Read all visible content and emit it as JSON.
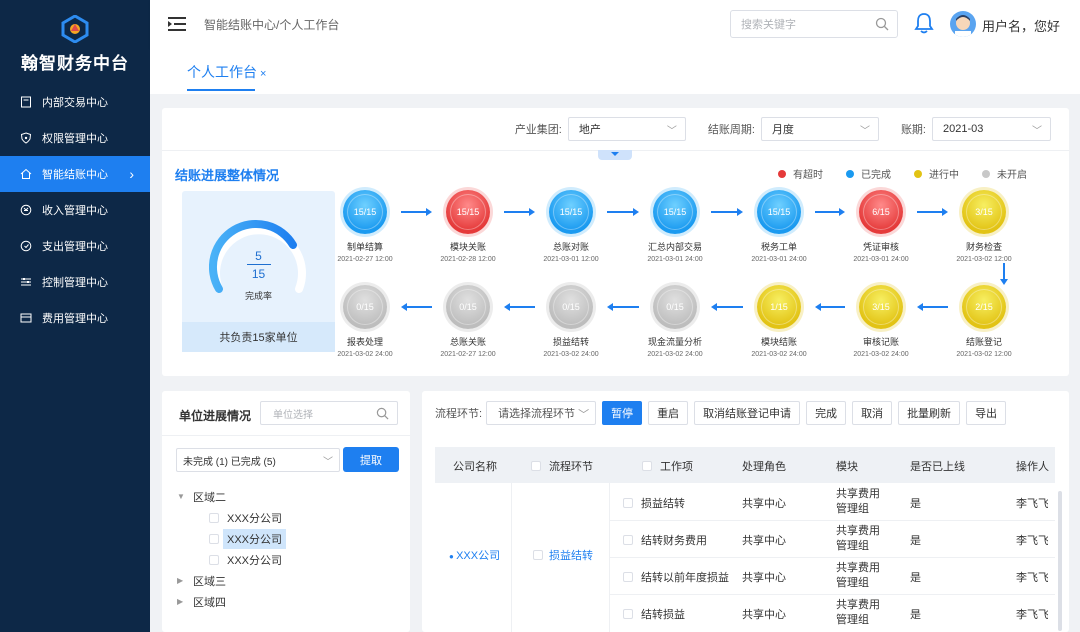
{
  "app": {
    "logo_text": "翰智财务中台",
    "breadcrumb": "智能结账中心/个人工作台",
    "search_placeholder": "搜索关键字",
    "username": "用户名，您好"
  },
  "sidebar": {
    "items": [
      {
        "label": "内部交易中心",
        "icon": "document-icon"
      },
      {
        "label": "权限管理中心",
        "icon": "shield-icon"
      },
      {
        "label": "智能结账中心",
        "icon": "home-icon"
      },
      {
        "label": "收入管理中心",
        "icon": "income-icon"
      },
      {
        "label": "支出管理中心",
        "icon": "expense-icon"
      },
      {
        "label": "控制管理中心",
        "icon": "sliders-icon"
      },
      {
        "label": "费用管理中心",
        "icon": "card-icon"
      }
    ],
    "active_index": 2
  },
  "tabs": [
    {
      "label": "个人工作台",
      "close": "×"
    }
  ],
  "filters": {
    "group_label": "产业集团:",
    "group_value": "地产",
    "period_label": "结账周期:",
    "period_value": "月度",
    "term_label": "账期:",
    "term_value": "2021-03"
  },
  "progress": {
    "title": "结账进展整体情况",
    "legend": [
      {
        "label": "有超时",
        "color": "#e53a3a"
      },
      {
        "label": "已完成",
        "color": "#1a9af0"
      },
      {
        "label": "进行中",
        "color": "#e2c314"
      },
      {
        "label": "未开启",
        "color": "#c8c8c8"
      }
    ],
    "summary": {
      "numerator": "5",
      "denominator": "15",
      "rate_label": "完成率",
      "footer": "共负责15家单位",
      "completion_fraction": 0.33
    },
    "row1": [
      {
        "count": "15/15",
        "name": "制单结算",
        "time": "2021-02-27 12:00",
        "status": "blue"
      },
      {
        "count": "15/15",
        "name": "模块关账",
        "time": "2021-02-28 12:00",
        "status": "red"
      },
      {
        "count": "15/15",
        "name": "总账对账",
        "time": "2021-03-01 12:00",
        "status": "blue"
      },
      {
        "count": "15/15",
        "name": "汇总内部交易",
        "time": "2021-03-01 24:00",
        "status": "blue"
      },
      {
        "count": "15/15",
        "name": "税务工单",
        "time": "2021-03-01 24:00",
        "status": "blue"
      },
      {
        "count": "6/15",
        "name": "凭证审核",
        "time": "2021-03-01 24:00",
        "status": "red"
      },
      {
        "count": "3/15",
        "name": "财务检查",
        "time": "2021-03-02 12:00",
        "status": "yellow"
      }
    ],
    "row2": [
      {
        "count": "0/15",
        "name": "报表处理",
        "time": "2021-03-02 24:00",
        "status": "gray"
      },
      {
        "count": "0/15",
        "name": "总账关账",
        "time": "2021-02-27 12:00",
        "status": "gray"
      },
      {
        "count": "0/15",
        "name": "损益结转",
        "time": "2021-03-02 24:00",
        "status": "gray"
      },
      {
        "count": "0/15",
        "name": "现金流量分析",
        "time": "2021-03-02 24:00",
        "status": "gray"
      },
      {
        "count": "1/15",
        "name": "模块结账",
        "time": "2021-03-02 24:00",
        "status": "yellow"
      },
      {
        "count": "3/15",
        "name": "审核记账",
        "time": "2021-03-02 24:00",
        "status": "yellow"
      },
      {
        "count": "2/15",
        "name": "结账登记",
        "time": "2021-03-02 12:00",
        "status": "yellow"
      }
    ]
  },
  "unit_panel": {
    "title": "单位进展情况",
    "search_placeholder": "单位选择",
    "status_filter": "未完成 (1)  已完成 (5)",
    "fetch_button": "提取",
    "tree": [
      {
        "label": "区域二",
        "expanded": true,
        "children": [
          "XXX分公司",
          "XXX分公司",
          "XXX分公司"
        ]
      },
      {
        "label": "区域三",
        "expanded": false
      },
      {
        "label": "区域四",
        "expanded": false
      }
    ],
    "selected_child": 1
  },
  "process_panel": {
    "label": "流程环节:",
    "select_placeholder": "请选择流程环节",
    "buttons": [
      "暂停",
      "重启",
      "取消结账登记申请",
      "完成",
      "取消",
      "批量刷新",
      "导出"
    ],
    "columns": [
      "公司名称",
      "流程环节",
      "工作项",
      "处理角色",
      "模块",
      "是否已上线",
      "操作人"
    ],
    "company": "XXX公司",
    "process": "损益结转",
    "rows": [
      {
        "work": "损益结转",
        "role": "共享中心",
        "module": [
          "共享费用",
          "管理组"
        ],
        "online": "是",
        "operator": "李飞飞"
      },
      {
        "work": "结转财务费用",
        "role": "共享中心",
        "module": [
          "共享费用",
          "管理组"
        ],
        "online": "是",
        "operator": "李飞飞"
      },
      {
        "work": "结转以前年度损益",
        "role": "共享中心",
        "module": [
          "共享费用",
          "管理组"
        ],
        "online": "是",
        "operator": "李飞飞"
      },
      {
        "work": "结转损益",
        "role": "共享中心",
        "module": [
          "共享费用",
          "管理组"
        ],
        "online": "是",
        "operator": "李飞飞"
      }
    ]
  }
}
